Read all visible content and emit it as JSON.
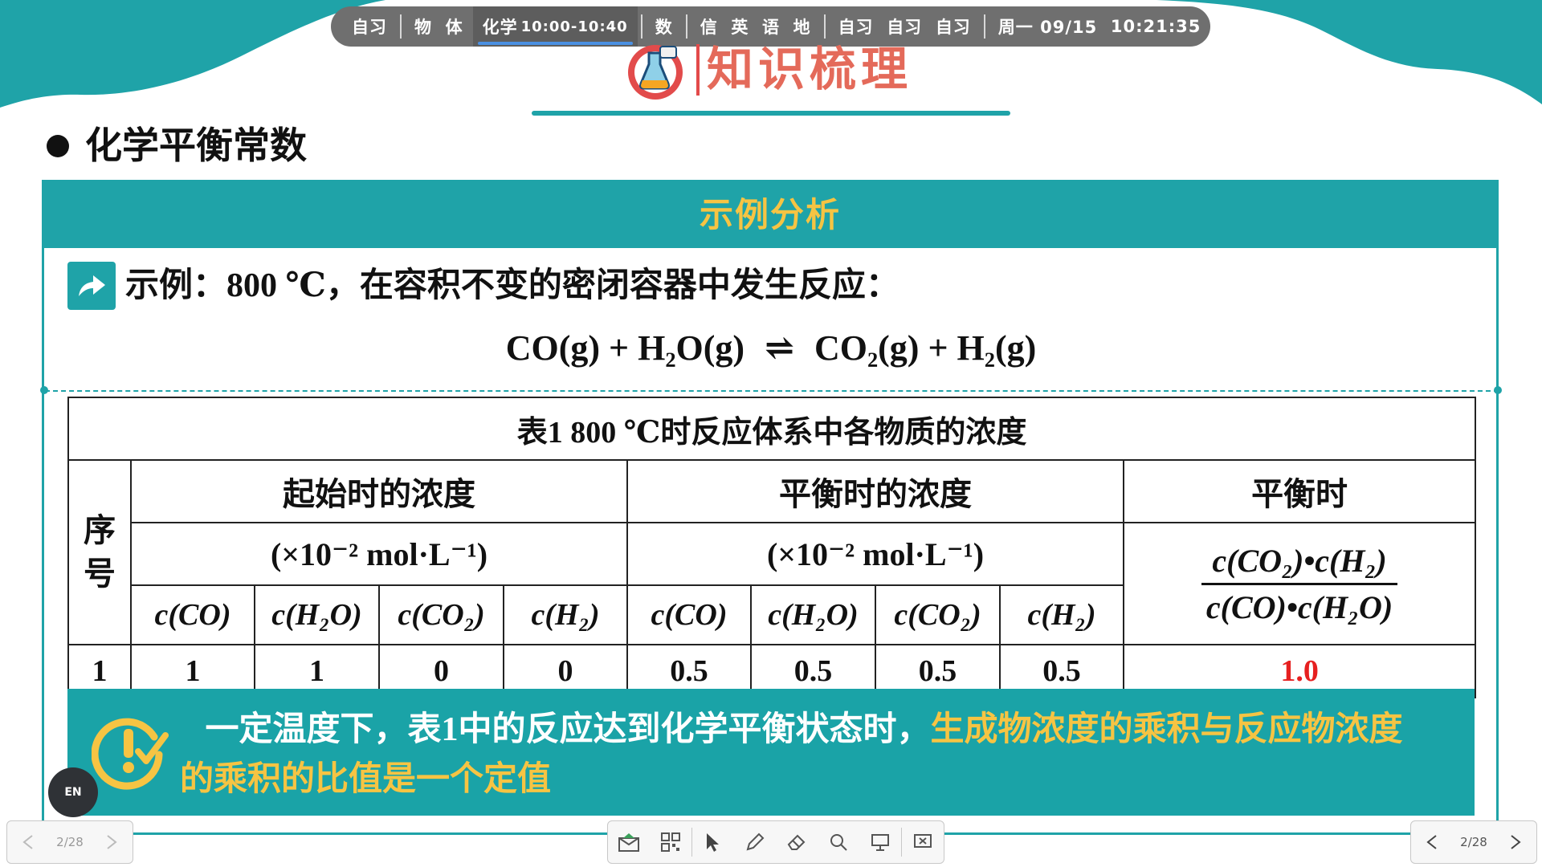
{
  "schedule": {
    "items": [
      "自习",
      "物",
      "体",
      "化学",
      "数",
      "信",
      "英",
      "语",
      "地",
      "自习",
      "自习",
      "自习"
    ],
    "active_time": "10:00-10:40",
    "date": "周一 09/15",
    "clock": "10:21:35"
  },
  "header": {
    "title": "知识梳理"
  },
  "section": {
    "title": "化学平衡常数"
  },
  "panel": {
    "head": "示例分析",
    "example": "示例：800 ℃，在容积不变的密闭容器中发生反应：",
    "equation_left": "CO(g) + H₂O(g)",
    "equation_arrow": "⇌",
    "equation_right": "CO₂(g) + H₂(g)"
  },
  "table": {
    "caption": "表1  800 ℃时反应体系中各物质的浓度",
    "col_index": "序号",
    "col_initial": "起始时的浓度",
    "col_equilibrium": "平衡时的浓度",
    "col_ratio": "平衡时",
    "unit": "(×10⁻² mol·L⁻¹)",
    "ratio_num": "c(CO₂)•c(H₂)",
    "ratio_den": "c(CO)•c(H₂O)",
    "sub_headers": [
      "c(CO)",
      "c(H₂O)",
      "c(CO₂)",
      "c(H₂)",
      "c(CO)",
      "c(H₂O)",
      "c(CO₂)",
      "c(H₂)"
    ],
    "rows": [
      {
        "index": "1",
        "values": [
          "1",
          "1",
          "0",
          "0",
          "0.5",
          "0.5",
          "0.5",
          "0.5"
        ],
        "ratio": "1.0"
      }
    ]
  },
  "note": {
    "text_plain": "一定温度下，表1中的反应达到化学平衡状态时，",
    "text_highlight": "生成物浓度的乘积与反应物浓度的乘积的比值是一个定值"
  },
  "toolbar": {
    "en_label": "EN"
  },
  "pager": {
    "left": "2/28",
    "right": "2/28"
  },
  "colors": {
    "teal": "#1fa3a8",
    "title": "#e46a5a",
    "highlight": "#f6c443",
    "ratio": "#e62020"
  },
  "icons": [
    "mail-icon",
    "qr-icon",
    "pointer-icon",
    "pen-icon",
    "eraser-icon",
    "search-icon",
    "board-icon",
    "close-screen-icon"
  ]
}
